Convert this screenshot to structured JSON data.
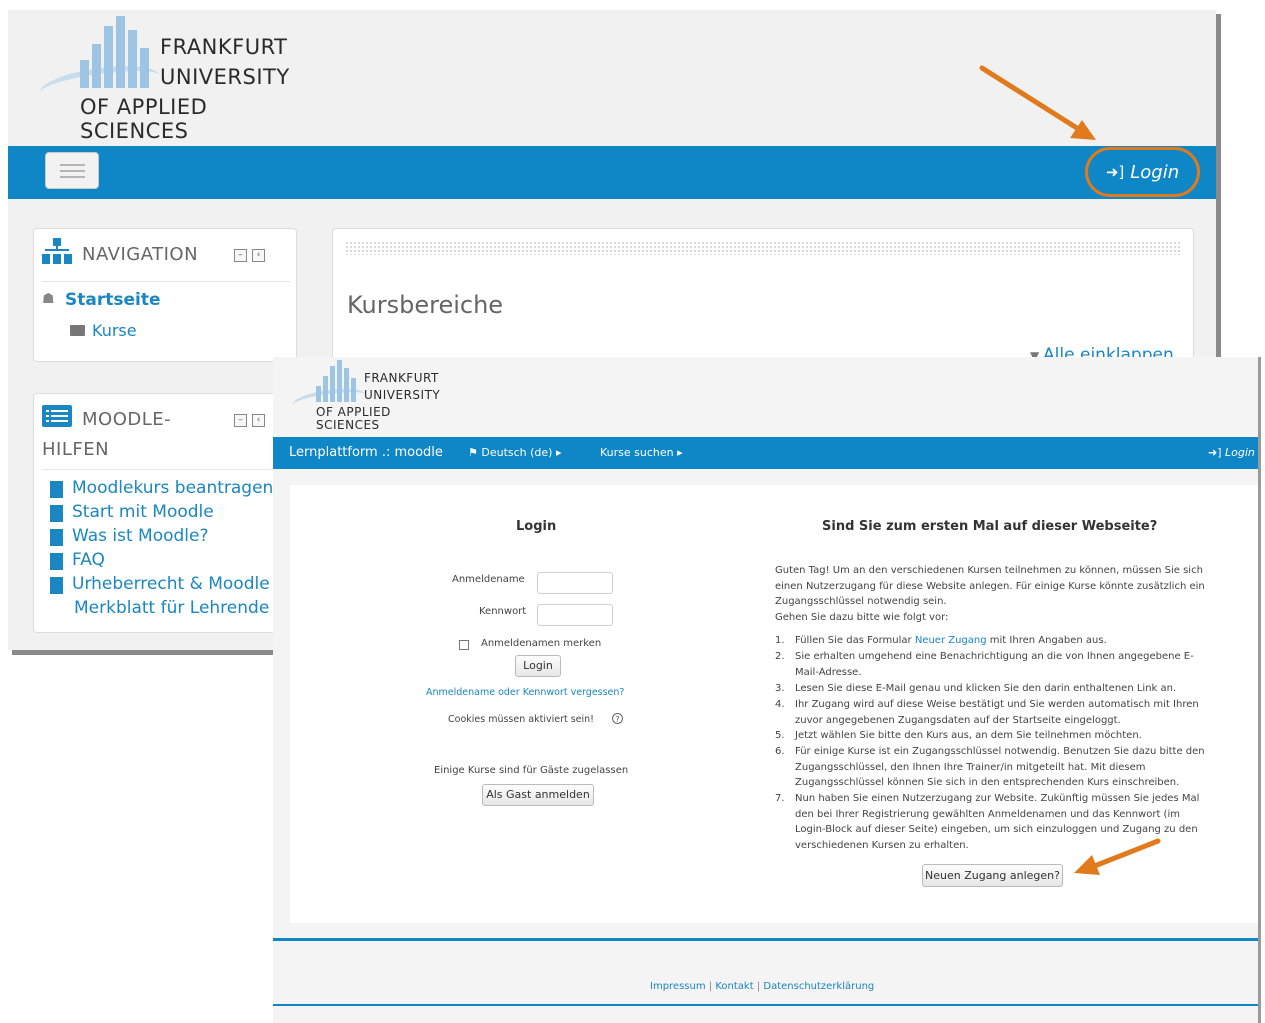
{
  "colors": {
    "brand_blue": "#0f86c6",
    "link_blue": "#1a86c2",
    "highlight_orange": "#e07a1c"
  },
  "back_page": {
    "logo": {
      "line1": "FRANKFURT",
      "line2": "UNIVERSITY",
      "line3": "OF APPLIED SCIENCES"
    },
    "navbar": {
      "login_label": "Login",
      "login_icon": "sign-in-icon",
      "menu_icon": "hamburger-icon"
    },
    "navigation_block": {
      "title": "NAVIGATION",
      "home_label": "Startseite",
      "home_icon": "home-icon",
      "courses_label": "Kurse",
      "courses_icon": "folder-icon"
    },
    "help_block": {
      "title_line1": "MOODLE-",
      "title_line2": "HILFEN",
      "links": [
        "Moodlekurs beantragen",
        "Start mit Moodle",
        "Was ist Moodle?",
        "FAQ",
        "Urheberrecht & Moodle",
        "Merkblatt für Lehrende"
      ]
    },
    "main": {
      "heading": "Kursbereiche",
      "collapse_all": "Alle einklappen"
    }
  },
  "front_page": {
    "logo": {
      "line1": "FRANKFURT",
      "line2": "UNIVERSITY",
      "line3": "OF APPLIED SCIENCES"
    },
    "navbar": {
      "brand": "Lernplattform .: moodle",
      "language": "Deutsch (de)",
      "course_search": "Kurse suchen",
      "login_label": "Login"
    },
    "login_form": {
      "title": "Login",
      "username_label": "Anmeldename",
      "username_value": "",
      "password_label": "Kennwort",
      "password_value": "",
      "remember_label": "Anmeldenamen merken",
      "remember_checked": false,
      "login_button": "Login",
      "forgot_link": "Anmeldename oder Kennwort vergessen?",
      "cookies_note": "Cookies müssen aktiviert sein!",
      "guest_note": "Einige Kurse sind für Gäste zugelassen",
      "guest_button": "Als Gast anmelden"
    },
    "first_time": {
      "title": "Sind Sie zum ersten Mal auf dieser Webseite?",
      "intro": "Guten Tag! Um an den verschiedenen Kursen teilnehmen zu können, müssen Sie sich einen Nutzerzugang für diese Website anlegen. Für einige Kurse könnte zusätzlich ein Zugangsschlüssel notwendig sein.",
      "intro2": "Gehen Sie dazu bitte wie folgt vor:",
      "step1_before": "Füllen Sie das Formular",
      "step1_link": "Neuer Zugang",
      "step1_after": "mit Ihren Angaben aus.",
      "steps": [
        "Sie erhalten umgehend eine Benachrichtigung an die von Ihnen angegebene E-Mail-Adresse.",
        "Lesen Sie diese E-Mail genau und klicken Sie den darin enthaltenen Link an.",
        "Ihr Zugang wird auf diese Weise bestätigt und Sie werden automatisch mit Ihren zuvor angegebenen Zugangsdaten auf der Startseite eingeloggt.",
        "Jetzt wählen Sie bitte den Kurs aus, an dem Sie teilnehmen möchten.",
        "Für einige Kurse ist ein Zugangsschlüssel notwendig. Benutzen Sie dazu bitte den Zugangsschlüssel, den Ihnen Ihre Trainer/in mitgeteilt hat. Mit diesem Zugangsschlüssel können Sie sich in den entsprechenden Kurs einschreiben.",
        "Nun haben Sie einen Nutzerzugang zur Website. Zukünftig müssen Sie jedes Mal den bei Ihrer Registrierung gewählten Anmeldenamen und das Kennwort (im Login-Block auf dieser Seite) eingeben, um sich einzuloggen und Zugang zu den verschiedenen Kursen zu erhalten."
      ],
      "new_account_button": "Neuen Zugang anlegen?"
    },
    "footer": {
      "links": [
        "Impressum",
        "Kontakt",
        "Datenschutzerklärung"
      ],
      "separator": "|"
    }
  }
}
